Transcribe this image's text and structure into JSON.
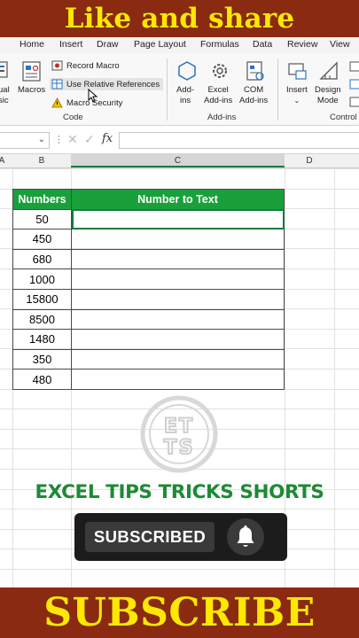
{
  "banner": {
    "top": "Like and share",
    "bottom": "SUBSCRIBE"
  },
  "ribbon_tabs": [
    "Home",
    "Insert",
    "Draw",
    "Page Layout",
    "Formulas",
    "Data",
    "Review",
    "View"
  ],
  "ribbon": {
    "visual_basic": [
      "ual",
      "sic"
    ],
    "macros": "Macros",
    "record_macro": "Record Macro",
    "use_relative": "Use Relative References",
    "macro_security": "Macro Security",
    "code_group": "Code",
    "add_ins": [
      "Add-",
      "ins"
    ],
    "excel_add_ins": [
      "Excel",
      "Add-ins"
    ],
    "com_add_ins": [
      "COM",
      "Add-ins"
    ],
    "add_ins_group": "Add-ins",
    "insert": "Insert",
    "design_mode": [
      "Design",
      "Mode"
    ],
    "controls_group": "Control"
  },
  "formula_bar": {
    "fx": "fx",
    "name_box": "",
    "formula": ""
  },
  "columns": [
    "A",
    "B",
    "C",
    "D"
  ],
  "table": {
    "headers": [
      "Numbers",
      "Number to Text"
    ],
    "rows": [
      "50",
      "450",
      "680",
      "1000",
      "15800",
      "8500",
      "1480",
      "350",
      "480"
    ]
  },
  "logo_text": "ETTS",
  "channel_text": "EXCEL TIPS TRICKS SHORTS",
  "subscribe": {
    "label": "SUBSCRIBED"
  },
  "colors": {
    "banner": "#8a2a10",
    "banner_text": "#ffe800",
    "header_green": "#1aa03a",
    "channel_green": "#1e8a35"
  }
}
